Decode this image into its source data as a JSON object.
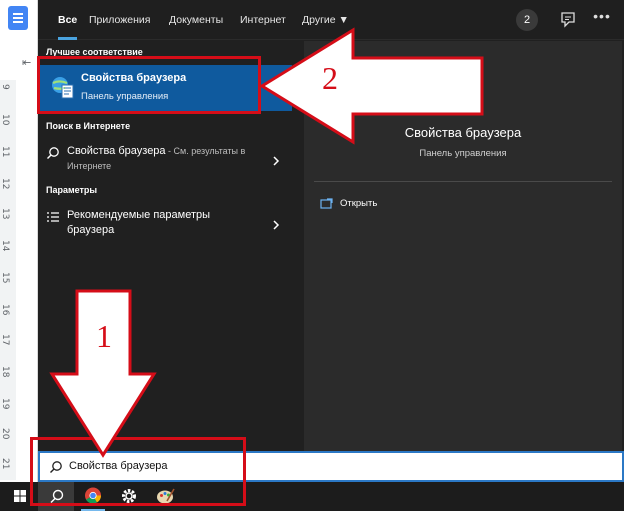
{
  "background_doc": {
    "ruler_numbers": [
      "9",
      "10",
      "11",
      "12",
      "13",
      "14",
      "15",
      "16",
      "17",
      "18",
      "19",
      "20",
      "21"
    ]
  },
  "tabs": {
    "all": "Все",
    "apps": "Приложения",
    "documents": "Документы",
    "internet": "Интернет",
    "other": "Другие ▼",
    "badge_count": "2"
  },
  "left": {
    "best_match_title": "Лучшее соответствие",
    "best_match": {
      "title": "Свойства браузера",
      "subtitle": "Панель управления"
    },
    "web_section_title": "Поиск в Интернете",
    "web_result": {
      "text": "Свойства браузера",
      "suffix": " - См. результаты в Интернете"
    },
    "settings_section_title": "Параметры",
    "settings_result": {
      "text": "Рекомендуемые параметры браузера"
    }
  },
  "preview": {
    "title": "Свойства браузера",
    "subtitle": "Панель управления",
    "open_label": "Открыть"
  },
  "search": {
    "value": "Свойства браузера"
  },
  "annotations": {
    "label_1": "1",
    "label_2": "2",
    "color": "#d50d18"
  },
  "icons": [
    "search-icon",
    "chevron-right-icon",
    "settings-list-icon",
    "open-window-icon",
    "windows-logo-icon",
    "chrome-icon",
    "gear-icon",
    "paint-icon",
    "feedback-icon",
    "more-icon",
    "internet-options-icon"
  ]
}
